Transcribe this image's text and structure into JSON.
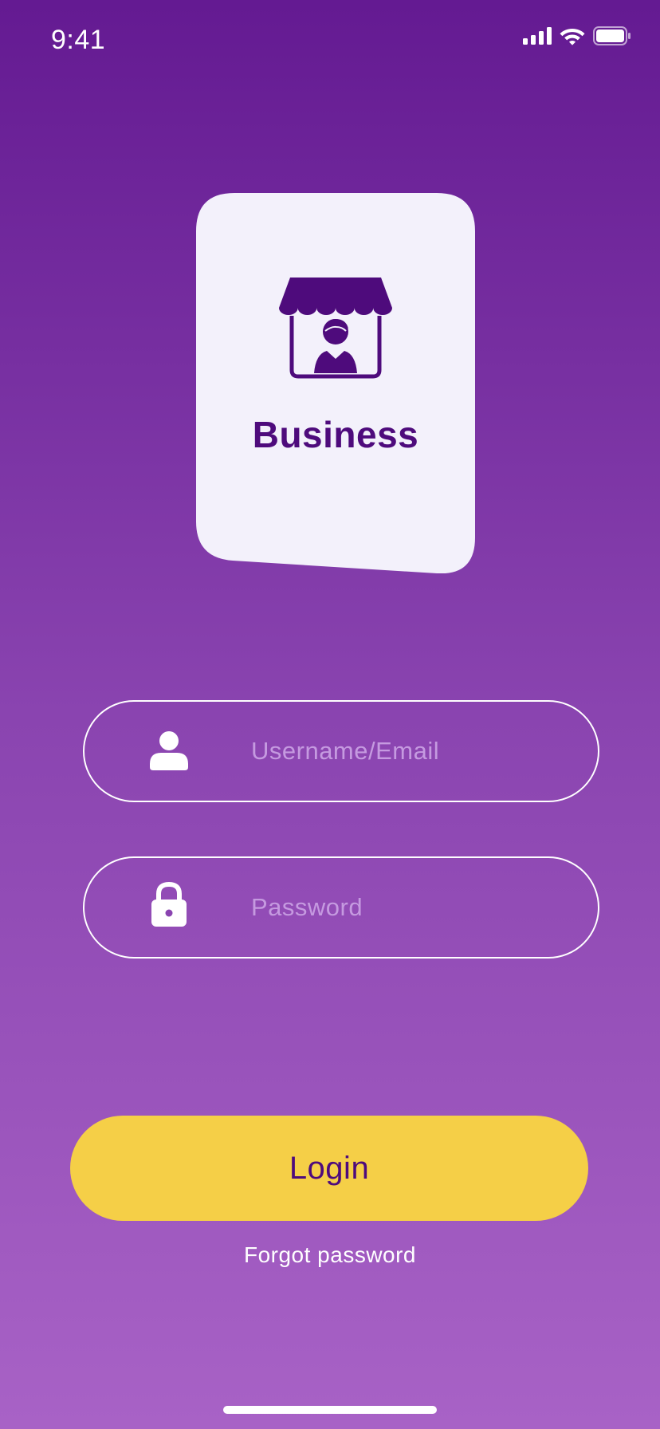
{
  "status_bar": {
    "time": "9:41",
    "signal_icon": "cellular-signal-icon",
    "wifi_icon": "wifi-icon",
    "battery_icon": "battery-icon"
  },
  "card": {
    "icon": "shop-vendor-icon",
    "label": "Business"
  },
  "form": {
    "username": {
      "icon": "user-icon",
      "placeholder": "Username/Email",
      "value": ""
    },
    "password": {
      "icon": "lock-icon",
      "placeholder": "Password",
      "value": ""
    }
  },
  "login_label": "Login",
  "forgot_label": "Forgot password",
  "colors": {
    "gradient_top": "#641a92",
    "gradient_bottom": "#a862c6",
    "card_bg": "#f3f1fb",
    "brand_purple": "#4e0b7c",
    "button_yellow": "#f5cf47",
    "placeholder": "#c59ae0"
  }
}
